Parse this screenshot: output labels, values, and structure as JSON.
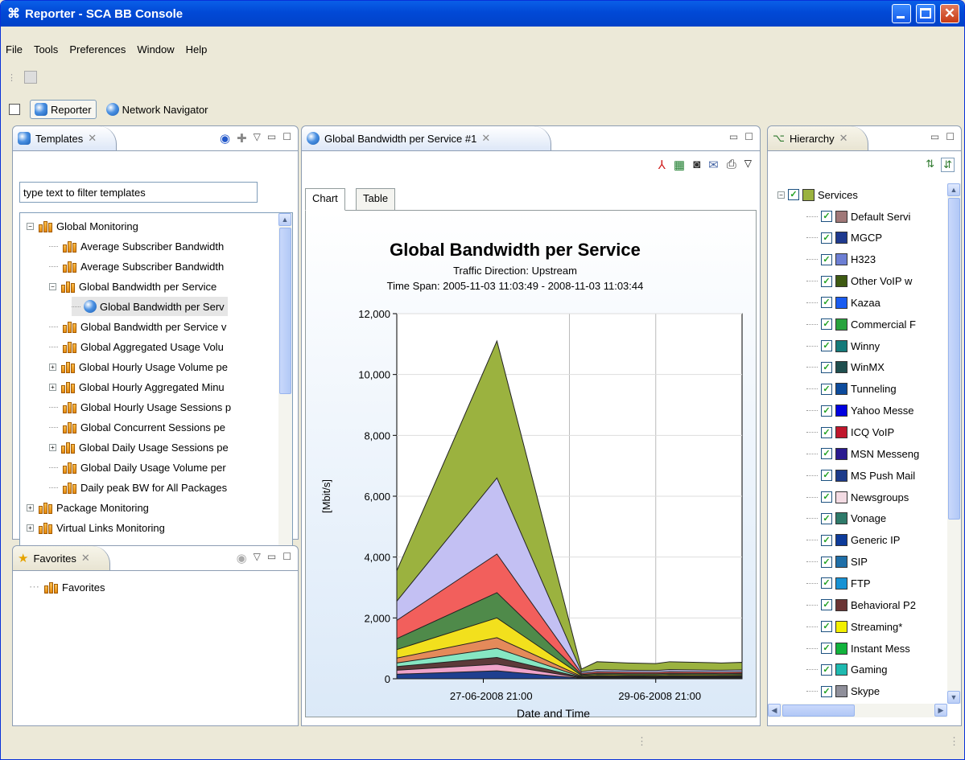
{
  "window": {
    "title": "Reporter - SCA BB Console"
  },
  "menu": [
    "File",
    "Tools",
    "Preferences",
    "Window",
    "Help"
  ],
  "perspectives": {
    "reporter": "Reporter",
    "network_navigator": "Network Navigator"
  },
  "templates_panel": {
    "title": "Templates",
    "filter_placeholder": "type text to filter templates",
    "tree": [
      {
        "label": "Global Monitoring",
        "level": 0,
        "expander": "-",
        "icon": "template-group-icon"
      },
      {
        "label": "Average Subscriber Bandwidth",
        "level": 1,
        "expander": "",
        "icon": "template-icon"
      },
      {
        "label": "Average Subscriber Bandwidth",
        "level": 1,
        "expander": "",
        "icon": "template-icon"
      },
      {
        "label": "Global Bandwidth per Service",
        "level": 1,
        "expander": "-",
        "icon": "template-icon"
      },
      {
        "label": "Global Bandwidth per Serv",
        "level": 2,
        "expander": "",
        "icon": "report-icon"
      },
      {
        "label": "Global Bandwidth per Service v",
        "level": 1,
        "expander": "",
        "icon": "template-icon"
      },
      {
        "label": "Global Aggregated Usage Volu",
        "level": 1,
        "expander": "",
        "icon": "template-icon"
      },
      {
        "label": "Global Hourly Usage Volume pe",
        "level": 1,
        "expander": "+",
        "icon": "template-icon"
      },
      {
        "label": "Global Hourly Aggregated Minu",
        "level": 1,
        "expander": "+",
        "icon": "template-icon"
      },
      {
        "label": "Global Hourly Usage Sessions p",
        "level": 1,
        "expander": "",
        "icon": "template-icon"
      },
      {
        "label": "Global Concurrent Sessions pe",
        "level": 1,
        "expander": "",
        "icon": "template-icon"
      },
      {
        "label": "Global Daily Usage Sessions pe",
        "level": 1,
        "expander": "+",
        "icon": "template-icon"
      },
      {
        "label": "Global Daily Usage Volume per",
        "level": 1,
        "expander": "",
        "icon": "template-icon"
      },
      {
        "label": "Daily peak BW for All Packages",
        "level": 1,
        "expander": "",
        "icon": "template-icon"
      },
      {
        "label": "Package Monitoring",
        "level": 0,
        "expander": "+",
        "icon": "template-group-icon"
      },
      {
        "label": "Virtual Links Monitoring",
        "level": 0,
        "expander": "+",
        "icon": "template-group-icon"
      }
    ],
    "scroll_fraction": 0.52
  },
  "favorites_panel": {
    "title": "Favorites",
    "item": "Favorites"
  },
  "report_panel": {
    "tab_title": "Global Bandwidth per Service #1",
    "subtabs": [
      "Chart",
      "Table"
    ],
    "active_subtab": "Chart",
    "chart_data": {
      "type": "area",
      "title": "Global Bandwidth per Service",
      "subtitle_1": "Traffic Direction: Upstream",
      "subtitle_2": "Time Span: 2005-11-03 11:03:49 - 2008-11-03 11:03:44",
      "ylabel": "[Mbit/s]",
      "xlabel": "Date and Time",
      "ylim": [
        0,
        12000
      ],
      "y_ticks": [
        "0",
        "2,000",
        "4,000",
        "6,000",
        "8,000",
        "10,000",
        "12,000"
      ],
      "x_ticks": [
        "27-06-2008 21:00",
        "29-06-2008 21:00"
      ],
      "grid": true,
      "stacked_totals": [
        {
          "name": "layer1",
          "color": "#9bb23f",
          "values": [
            3550,
            11100,
            320,
            560,
            520,
            500,
            560,
            520,
            540
          ]
        },
        {
          "name": "layer2",
          "color": "#c3c0f3",
          "values": [
            2550,
            6600,
            230,
            300,
            280,
            270,
            300,
            280,
            290
          ]
        },
        {
          "name": "layer3",
          "color": "#f25f5c",
          "values": [
            1920,
            4100,
            180,
            230,
            220,
            210,
            230,
            220,
            225
          ]
        },
        {
          "name": "layer4",
          "color": "#4f8a4a",
          "values": [
            1320,
            2830,
            140,
            180,
            170,
            165,
            180,
            170,
            175
          ]
        },
        {
          "name": "layer5",
          "color": "#f2e01d",
          "values": [
            960,
            2000,
            110,
            140,
            130,
            125,
            140,
            130,
            135
          ]
        },
        {
          "name": "layer6",
          "color": "#e48a5a",
          "values": [
            680,
            1350,
            80,
            100,
            95,
            90,
            100,
            95,
            98
          ]
        },
        {
          "name": "layer7",
          "color": "#86e6c3",
          "values": [
            520,
            1000,
            60,
            80,
            75,
            70,
            80,
            75,
            78
          ]
        },
        {
          "name": "layer8",
          "color": "#5d3a3a",
          "values": [
            400,
            700,
            45,
            60,
            55,
            52,
            60,
            55,
            58
          ]
        },
        {
          "name": "layer9",
          "color": "#f0a3c9",
          "values": [
            280,
            480,
            30,
            40,
            38,
            36,
            40,
            38,
            39
          ]
        },
        {
          "name": "layer10",
          "color": "#1f3f8f",
          "values": [
            150,
            260,
            18,
            25,
            22,
            20,
            25,
            22,
            23
          ]
        }
      ]
    }
  },
  "hierarchy_panel": {
    "title": "Hierarchy",
    "root": {
      "label": "Services",
      "color": "#9bb23f"
    },
    "services": [
      {
        "label": "Default Servi",
        "color": "#a07878"
      },
      {
        "label": "MGCP",
        "color": "#1f3a8f"
      },
      {
        "label": "H323",
        "color": "#6d7fd4"
      },
      {
        "label": "Other VoIP w",
        "color": "#3e5a12"
      },
      {
        "label": "Kazaa",
        "color": "#1a5cf0"
      },
      {
        "label": "Commercial F",
        "color": "#27a33d"
      },
      {
        "label": "Winny",
        "color": "#157a7a"
      },
      {
        "label": "WinMX",
        "color": "#1f4f4f"
      },
      {
        "label": "Tunneling",
        "color": "#0d4b9c"
      },
      {
        "label": "Yahoo Messe",
        "color": "#0000e0"
      },
      {
        "label": "ICQ VoIP",
        "color": "#c0172c"
      },
      {
        "label": "MSN Messeng",
        "color": "#2a1a8f"
      },
      {
        "label": "MS Push Mail",
        "color": "#1d3b8a"
      },
      {
        "label": "Newsgroups",
        "color": "#f3dbe3"
      },
      {
        "label": "Vonage",
        "color": "#2e7a6a"
      },
      {
        "label": "Generic IP",
        "color": "#0d3b9a"
      },
      {
        "label": "SIP",
        "color": "#1f6fa8"
      },
      {
        "label": "FTP",
        "color": "#1892d4"
      },
      {
        "label": "Behavioral P2",
        "color": "#6b3434"
      },
      {
        "label": "Streaming*",
        "color": "#f2ef00"
      },
      {
        "label": "Instant Mess",
        "color": "#12b33d"
      },
      {
        "label": "Gaming",
        "color": "#1fbab0"
      },
      {
        "label": "Skype",
        "color": "#8f8f9a"
      }
    ]
  }
}
